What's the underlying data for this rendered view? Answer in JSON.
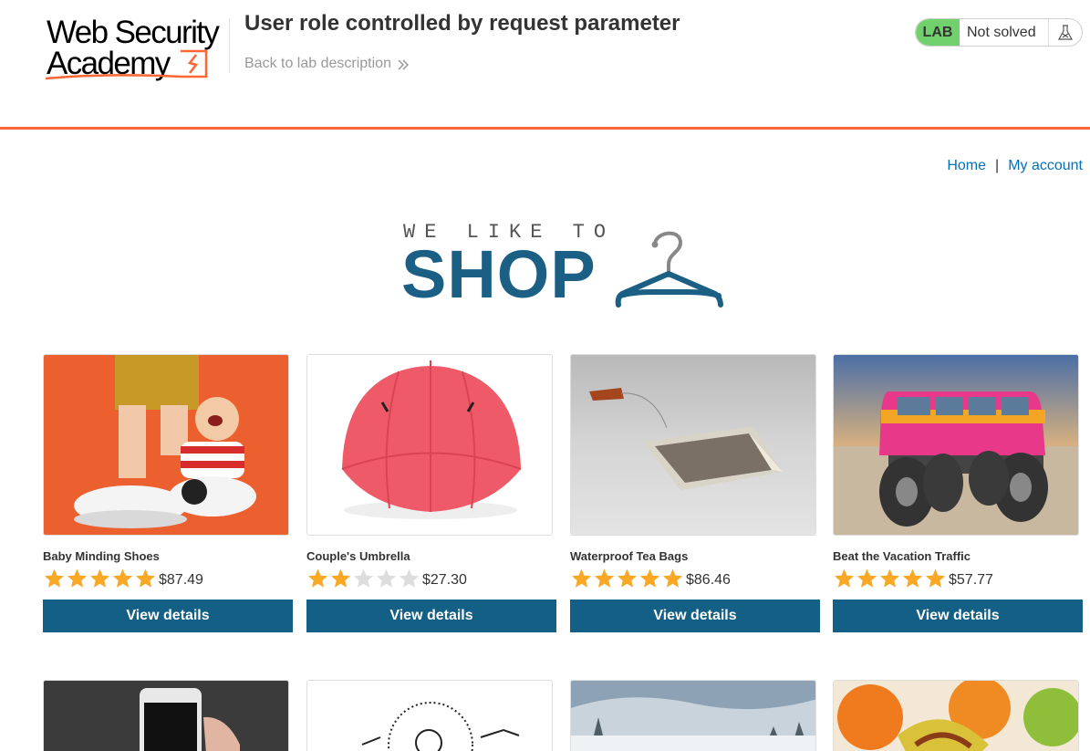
{
  "header": {
    "logo_line1": "Web Security",
    "logo_line2": "Academy",
    "lab_title": "User role controlled by request parameter",
    "back_link": "Back to lab description",
    "status_badge": "LAB",
    "status_text": "Not solved",
    "colors": {
      "accent": "#ff6633",
      "lab_green": "#70d16d"
    }
  },
  "nav": {
    "home": "Home",
    "separator": "|",
    "my_account": "My account"
  },
  "banner": {
    "tagline": "WE LIKE TO",
    "title": "SHOP",
    "icon": "hanger-icon"
  },
  "products": [
    {
      "name": "Baby Minding Shoes",
      "rating": 5,
      "price": "$87.49",
      "button": "View details"
    },
    {
      "name": "Couple's Umbrella",
      "rating": 2,
      "price": "$27.30",
      "button": "View details"
    },
    {
      "name": "Waterproof Tea Bags",
      "rating": 5,
      "price": "$86.46",
      "button": "View details"
    },
    {
      "name": "Beat the Vacation Traffic",
      "rating": 5,
      "price": "$57.77",
      "button": "View details"
    }
  ],
  "colors": {
    "button_bg": "#135f85",
    "link": "#0071bc",
    "star_on": "#f9a825",
    "star_off": "#dddddd"
  }
}
